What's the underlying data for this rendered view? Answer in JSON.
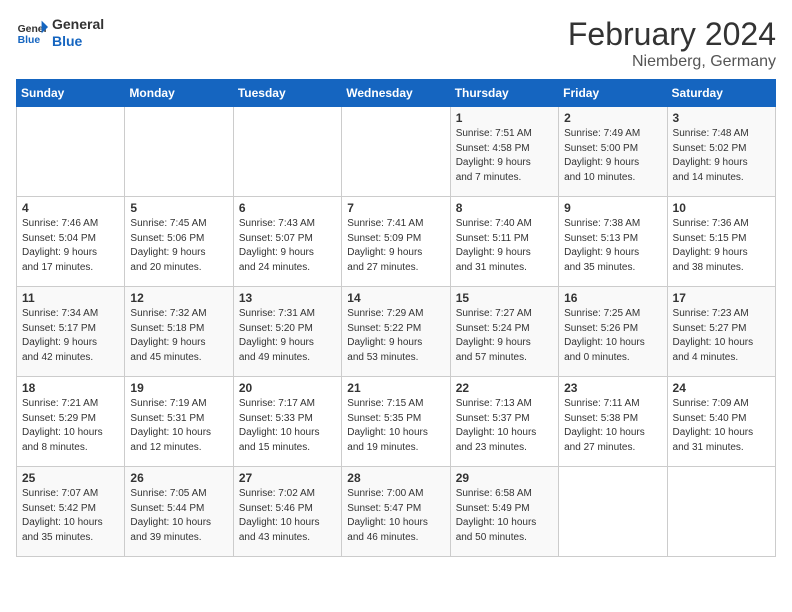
{
  "logo": {
    "line1": "General",
    "line2": "Blue"
  },
  "title": "February 2024",
  "location": "Niemberg, Germany",
  "days_of_week": [
    "Sunday",
    "Monday",
    "Tuesday",
    "Wednesday",
    "Thursday",
    "Friday",
    "Saturday"
  ],
  "weeks": [
    [
      {
        "day": "",
        "info": ""
      },
      {
        "day": "",
        "info": ""
      },
      {
        "day": "",
        "info": ""
      },
      {
        "day": "",
        "info": ""
      },
      {
        "day": "1",
        "info": "Sunrise: 7:51 AM\nSunset: 4:58 PM\nDaylight: 9 hours\nand 7 minutes."
      },
      {
        "day": "2",
        "info": "Sunrise: 7:49 AM\nSunset: 5:00 PM\nDaylight: 9 hours\nand 10 minutes."
      },
      {
        "day": "3",
        "info": "Sunrise: 7:48 AM\nSunset: 5:02 PM\nDaylight: 9 hours\nand 14 minutes."
      }
    ],
    [
      {
        "day": "4",
        "info": "Sunrise: 7:46 AM\nSunset: 5:04 PM\nDaylight: 9 hours\nand 17 minutes."
      },
      {
        "day": "5",
        "info": "Sunrise: 7:45 AM\nSunset: 5:06 PM\nDaylight: 9 hours\nand 20 minutes."
      },
      {
        "day": "6",
        "info": "Sunrise: 7:43 AM\nSunset: 5:07 PM\nDaylight: 9 hours\nand 24 minutes."
      },
      {
        "day": "7",
        "info": "Sunrise: 7:41 AM\nSunset: 5:09 PM\nDaylight: 9 hours\nand 27 minutes."
      },
      {
        "day": "8",
        "info": "Sunrise: 7:40 AM\nSunset: 5:11 PM\nDaylight: 9 hours\nand 31 minutes."
      },
      {
        "day": "9",
        "info": "Sunrise: 7:38 AM\nSunset: 5:13 PM\nDaylight: 9 hours\nand 35 minutes."
      },
      {
        "day": "10",
        "info": "Sunrise: 7:36 AM\nSunset: 5:15 PM\nDaylight: 9 hours\nand 38 minutes."
      }
    ],
    [
      {
        "day": "11",
        "info": "Sunrise: 7:34 AM\nSunset: 5:17 PM\nDaylight: 9 hours\nand 42 minutes."
      },
      {
        "day": "12",
        "info": "Sunrise: 7:32 AM\nSunset: 5:18 PM\nDaylight: 9 hours\nand 45 minutes."
      },
      {
        "day": "13",
        "info": "Sunrise: 7:31 AM\nSunset: 5:20 PM\nDaylight: 9 hours\nand 49 minutes."
      },
      {
        "day": "14",
        "info": "Sunrise: 7:29 AM\nSunset: 5:22 PM\nDaylight: 9 hours\nand 53 minutes."
      },
      {
        "day": "15",
        "info": "Sunrise: 7:27 AM\nSunset: 5:24 PM\nDaylight: 9 hours\nand 57 minutes."
      },
      {
        "day": "16",
        "info": "Sunrise: 7:25 AM\nSunset: 5:26 PM\nDaylight: 10 hours\nand 0 minutes."
      },
      {
        "day": "17",
        "info": "Sunrise: 7:23 AM\nSunset: 5:27 PM\nDaylight: 10 hours\nand 4 minutes."
      }
    ],
    [
      {
        "day": "18",
        "info": "Sunrise: 7:21 AM\nSunset: 5:29 PM\nDaylight: 10 hours\nand 8 minutes."
      },
      {
        "day": "19",
        "info": "Sunrise: 7:19 AM\nSunset: 5:31 PM\nDaylight: 10 hours\nand 12 minutes."
      },
      {
        "day": "20",
        "info": "Sunrise: 7:17 AM\nSunset: 5:33 PM\nDaylight: 10 hours\nand 15 minutes."
      },
      {
        "day": "21",
        "info": "Sunrise: 7:15 AM\nSunset: 5:35 PM\nDaylight: 10 hours\nand 19 minutes."
      },
      {
        "day": "22",
        "info": "Sunrise: 7:13 AM\nSunset: 5:37 PM\nDaylight: 10 hours\nand 23 minutes."
      },
      {
        "day": "23",
        "info": "Sunrise: 7:11 AM\nSunset: 5:38 PM\nDaylight: 10 hours\nand 27 minutes."
      },
      {
        "day": "24",
        "info": "Sunrise: 7:09 AM\nSunset: 5:40 PM\nDaylight: 10 hours\nand 31 minutes."
      }
    ],
    [
      {
        "day": "25",
        "info": "Sunrise: 7:07 AM\nSunset: 5:42 PM\nDaylight: 10 hours\nand 35 minutes."
      },
      {
        "day": "26",
        "info": "Sunrise: 7:05 AM\nSunset: 5:44 PM\nDaylight: 10 hours\nand 39 minutes."
      },
      {
        "day": "27",
        "info": "Sunrise: 7:02 AM\nSunset: 5:46 PM\nDaylight: 10 hours\nand 43 minutes."
      },
      {
        "day": "28",
        "info": "Sunrise: 7:00 AM\nSunset: 5:47 PM\nDaylight: 10 hours\nand 46 minutes."
      },
      {
        "day": "29",
        "info": "Sunrise: 6:58 AM\nSunset: 5:49 PM\nDaylight: 10 hours\nand 50 minutes."
      },
      {
        "day": "",
        "info": ""
      },
      {
        "day": "",
        "info": ""
      }
    ]
  ]
}
